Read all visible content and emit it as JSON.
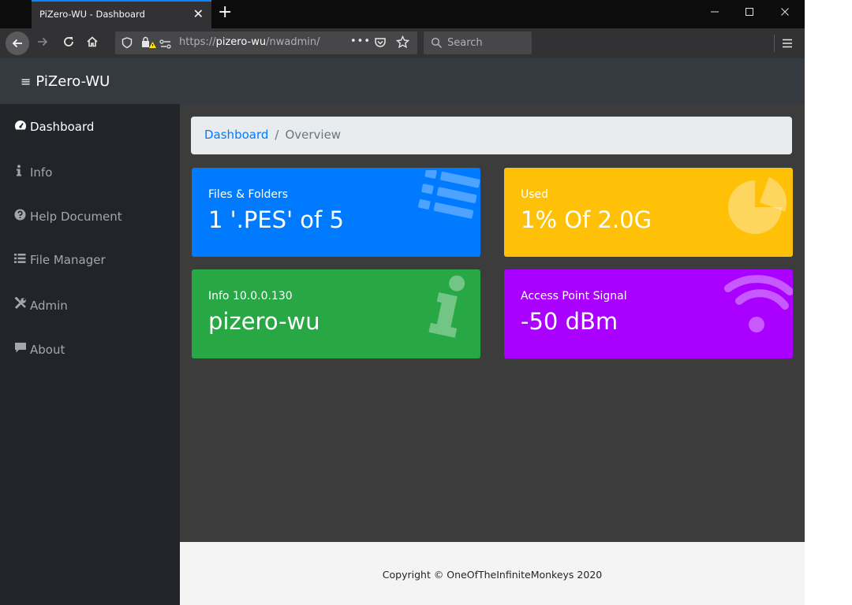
{
  "browser": {
    "tab_title": "PiZero-WU - Dashboard",
    "tab_close": "✕",
    "new_tab": "+",
    "url_prefix": "https://",
    "url_host": "pizero-wu",
    "url_path": "/nwadmin/",
    "search_placeholder": "Search",
    "menu_dots": "•••"
  },
  "app": {
    "brand": "PiZero-WU",
    "menu_icon": "≡"
  },
  "sidebar": {
    "items": [
      {
        "label": "Dashboard",
        "icon": "tachometer-icon",
        "active": true
      },
      {
        "label": "Info",
        "icon": "info-icon",
        "active": false
      },
      {
        "label": "Help Document",
        "icon": "question-circle-icon",
        "active": false
      },
      {
        "label": "File Manager",
        "icon": "list-icon",
        "active": false
      },
      {
        "label": "Admin",
        "icon": "tools-icon",
        "active": false
      },
      {
        "label": "About",
        "icon": "comment-icon",
        "active": false
      }
    ]
  },
  "breadcrumb": {
    "link": "Dashboard",
    "separator": "/",
    "current": "Overview"
  },
  "cards": [
    {
      "label": "Files & Folders",
      "value": "1 '.PES' of 5",
      "color": "#007bff",
      "icon": "list-icon"
    },
    {
      "label": "Used",
      "value": "1% Of 2.0G",
      "color": "#ffc107",
      "icon": "pie-chart-icon"
    },
    {
      "label": "Info 10.0.0.130",
      "value": "pizero-wu",
      "color": "#28a745",
      "icon": "info-icon"
    },
    {
      "label": "Access Point Signal",
      "value": "-50 dBm",
      "color": "#aa00ff",
      "icon": "wifi-icon"
    }
  ],
  "footer": {
    "text": "Copyright © OneOfTheInfiniteMonkeys 2020"
  }
}
